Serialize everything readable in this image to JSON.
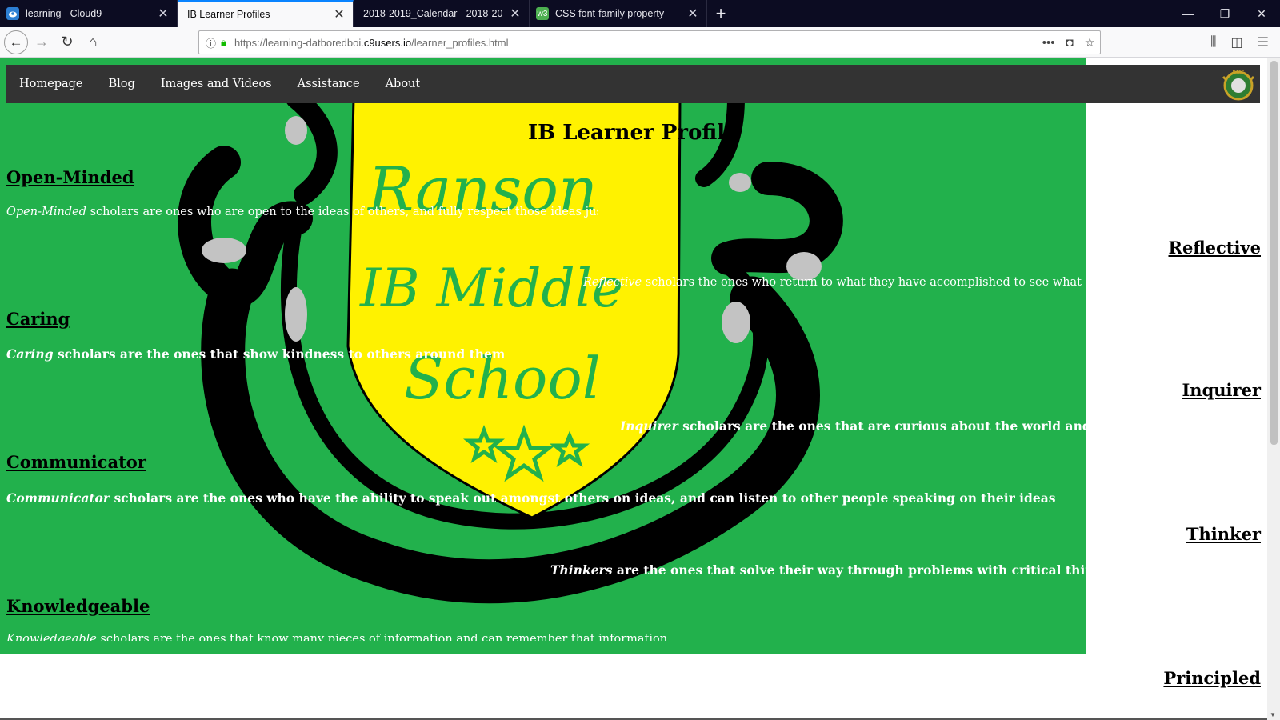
{
  "browser": {
    "tabs": [
      {
        "label": "learning - Cloud9",
        "icon": "cloud9-icon",
        "active": false
      },
      {
        "label": "IB Learner Profiles",
        "icon": "",
        "active": true
      },
      {
        "label": "2018-2019_Calendar - 2018-2019 Ac",
        "icon": "",
        "active": false
      },
      {
        "label": "CSS font-family property",
        "icon": "w3schools-icon",
        "active": false
      }
    ],
    "url_prefix": "https://learning-datboredboi.",
    "url_domain": "c9users.io",
    "url_path": "/learner_profiles.html"
  },
  "nav": {
    "links": [
      "Homepage",
      "Blog",
      "Images and Videos",
      "Assistance",
      "About"
    ],
    "logo_text": "RMS"
  },
  "page": {
    "title": "IB Learner Profile",
    "crest_text": [
      "Ranson",
      "IB Middle",
      "School"
    ],
    "traits": [
      {
        "heading": "Open-Minded",
        "term": "Open-Minded",
        "desc": " scholars are ones who are open to the ideas of others, and fully respect those ideas just the same"
      },
      {
        "heading": "Reflective",
        "term": "Reflective",
        "desc": " scholars the ones who return to what they have accomplished to see what could of been d"
      },
      {
        "heading": "Caring",
        "term": "Caring",
        "desc": " scholars are the ones that show kindness to others around them"
      },
      {
        "heading": "Inquirer",
        "term": "Inquirer",
        "desc": " scholars are the ones that are curious about the world and ask quest"
      },
      {
        "heading": "Communicator",
        "term": "Communicator",
        "desc": " scholars are the ones who have the ability to speak out amongst others on ideas, and can listen to other people speaking on their ideas"
      },
      {
        "heading": "Thinker",
        "term": "Thinkers",
        "desc": " are the ones that solve their way through problems with critical thinking, to co"
      },
      {
        "heading": "Knowledgeable",
        "term": "Knowledgeable",
        "desc": " scholars are the ones that know many pieces of information and can remember that information"
      },
      {
        "heading": "Principled",
        "term": "",
        "desc": ""
      }
    ]
  },
  "colors": {
    "page_bg": "#22b14c",
    "nav_bg": "#333333",
    "shield": "#fff200",
    "crest_text": "#22b14c"
  }
}
